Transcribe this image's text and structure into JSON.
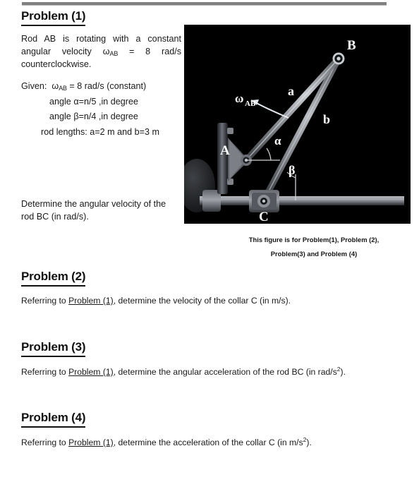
{
  "document": {
    "top_rule": "horizontal-rule"
  },
  "problem1": {
    "heading": "Problem (1)",
    "intro_line1": "Rod AB is rotating with a constant",
    "intro_line2_a": "angular velocity",
    "intro_line2_omega": "ω",
    "intro_line2_sub": "AB",
    "intro_line2_b": "= 8",
    "intro_line2_c": "rad/s",
    "intro_line3": "counterclockwise.",
    "given_label": "Given:",
    "given_omega": "ω",
    "given_omega_sub": "AB",
    "given_omega_value": "= 8 rad/s (constant)",
    "given_alpha": "angle  α=n/5   ,in degree",
    "given_beta": "angle  β=n/4   ,in degree",
    "given_lengths": "rod lengths:  a=2 m  and  b=3 m",
    "question_line1": "Determine the angular velocity of",
    "question_line2": "the rod BC (in rad/s)."
  },
  "figure": {
    "background_color": "#000000",
    "labels": {
      "point_a": "A",
      "point_b": "B",
      "point_c": "C",
      "link_a": "a",
      "link_b": "b",
      "angle_alpha": "α",
      "angle_beta": "β",
      "omega": "ω",
      "omega_sub": "AB"
    },
    "caption_line1": "This figure is for Problem(1), Problem (2),",
    "caption_line2": "Problem(3) and Problem (4)"
  },
  "problem2": {
    "heading": "Problem (2)",
    "body_before": "Referring to ",
    "body_xref": "Problem (1)",
    "body_after": ", determine the velocity of the collar C (in m/s)."
  },
  "problem3": {
    "heading": "Problem (3)",
    "body_before": "Referring to ",
    "body_xref": "Problem (1)",
    "body_after_a": ", determine the angular acceleration of the rod BC (in rad/s",
    "body_sup": "2",
    "body_after_b": ")."
  },
  "problem4": {
    "heading": "Problem (4)",
    "body_before": "Referring to ",
    "body_xref": "Problem (1)",
    "body_after_a": ", determine the acceleration of the collar C (in m/s",
    "body_sup": "2",
    "body_after_b": ")."
  }
}
